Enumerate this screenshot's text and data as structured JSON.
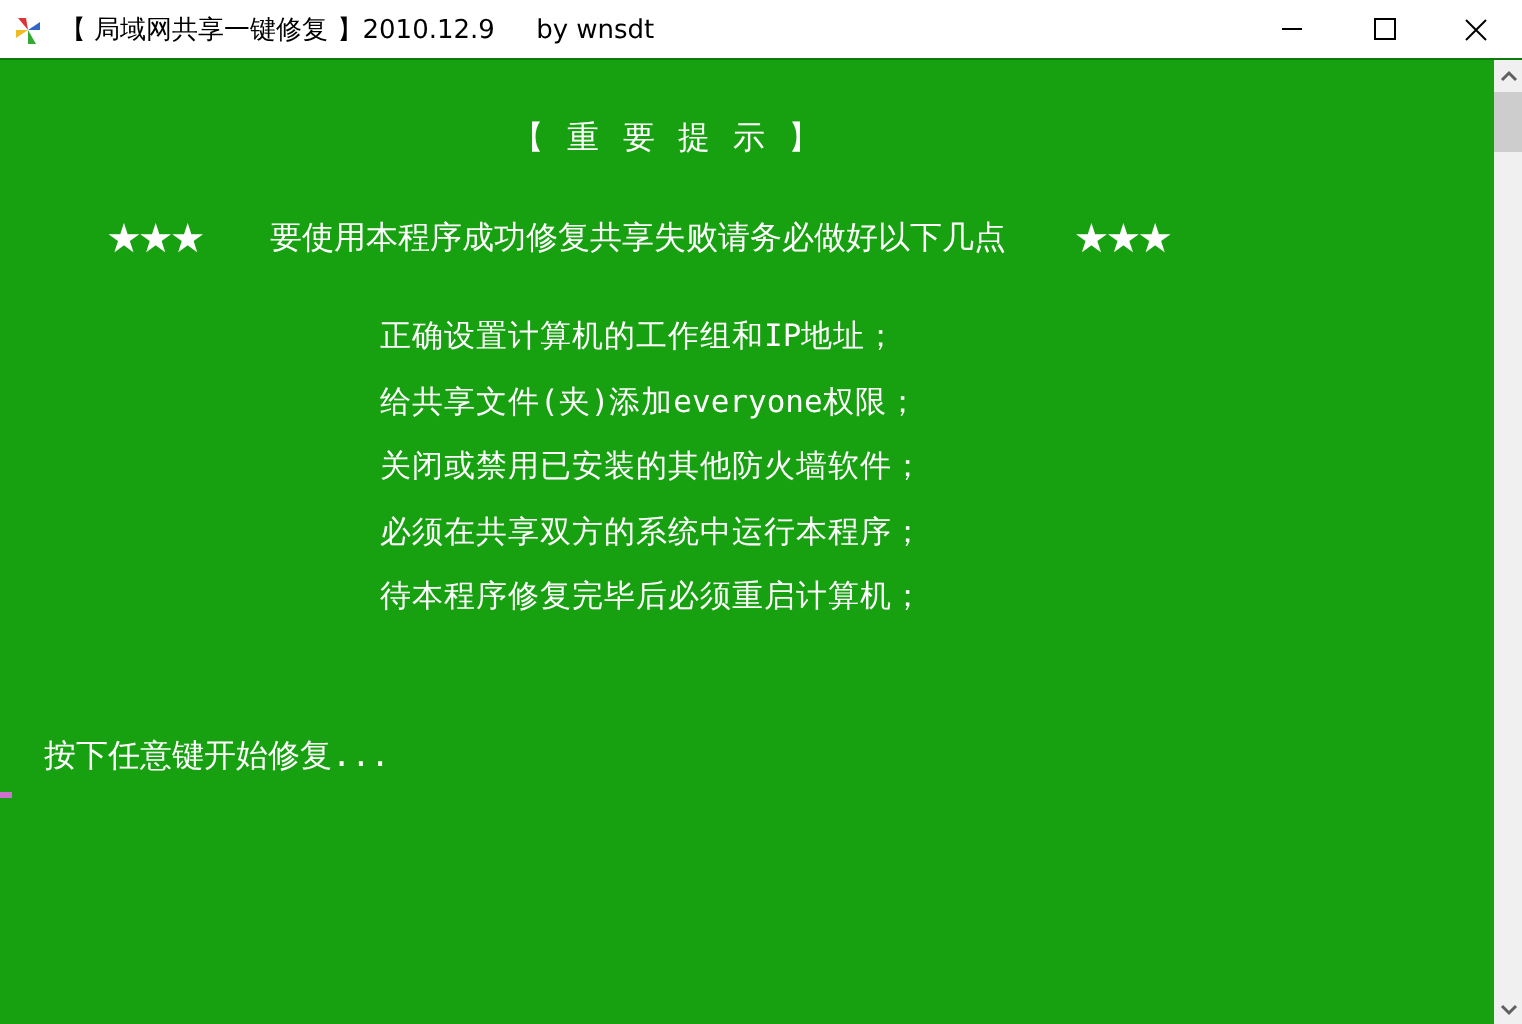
{
  "window": {
    "title": "【 局域网共享一键修复 】2010.12.9     by wnsdt"
  },
  "console": {
    "heading": "【 重 要 提 示 】",
    "notice": {
      "stars_left": "★★★",
      "text": "要使用本程序成功修复共享失败请务必做好以下几点",
      "stars_right": "★★★"
    },
    "points": [
      "正确设置计算机的工作组和IP地址；",
      "给共享文件(夹)添加everyone权限；",
      "关闭或禁用已安装的其他防火墙软件；",
      "必须在共享双方的系统中运行本程序；",
      "待本程序修复完毕后必须重启计算机；"
    ],
    "prompt": "按下任意键开始修复..."
  }
}
